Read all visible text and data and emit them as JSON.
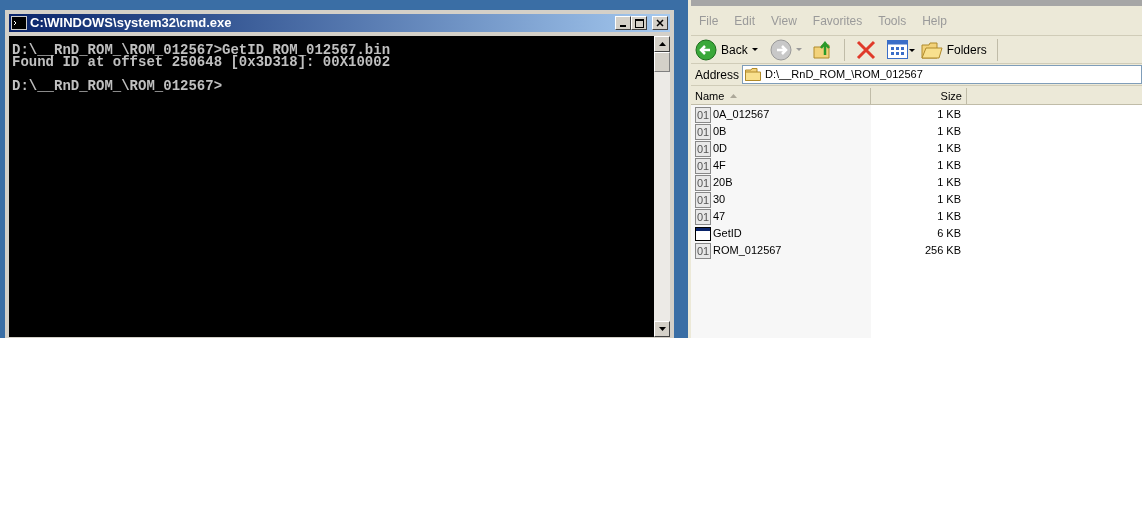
{
  "console": {
    "title": "C:\\WINDOWS\\system32\\cmd.exe",
    "lines": [
      {
        "kind": "text",
        "text": "D:\\__RnD_ROM_\\ROM_012567>GetID ROM_012567.bin"
      },
      {
        "kind": "text",
        "text": "Found ID at offset 250648 [0x3D318]: 00X10002"
      },
      {
        "kind": "blank"
      },
      {
        "kind": "text",
        "text": "D:\\__RnD_ROM_\\ROM_012567>"
      }
    ]
  },
  "explorer": {
    "menu": [
      "File",
      "Edit",
      "View",
      "Favorites",
      "Tools",
      "Help"
    ],
    "toolbar": {
      "back": "Back",
      "folders": "Folders"
    },
    "address": {
      "label": "Address",
      "value": "D:\\__RnD_ROM_\\ROM_012567"
    },
    "columns": [
      {
        "label": "Name",
        "sorted": true
      },
      {
        "label": "Size",
        "sorted": false
      }
    ],
    "files": [
      {
        "name": "0A_012567",
        "size": "1 KB",
        "kind": "binary",
        "icon_label": "01"
      },
      {
        "name": "0B",
        "size": "1 KB",
        "kind": "binary",
        "icon_label": "01"
      },
      {
        "name": "0D",
        "size": "1 KB",
        "kind": "binary",
        "icon_label": "01"
      },
      {
        "name": "4F",
        "size": "1 KB",
        "kind": "binary",
        "icon_label": "01"
      },
      {
        "name": "20B",
        "size": "1 KB",
        "kind": "binary",
        "icon_label": "01"
      },
      {
        "name": "30",
        "size": "1 KB",
        "kind": "binary",
        "icon_label": "01"
      },
      {
        "name": "47",
        "size": "1 KB",
        "kind": "binary",
        "icon_label": "01"
      },
      {
        "name": "GetID",
        "size": "6 KB",
        "kind": "application"
      },
      {
        "name": "ROM_012567",
        "size": "256 KB",
        "kind": "binary",
        "icon_label": "01"
      }
    ]
  }
}
